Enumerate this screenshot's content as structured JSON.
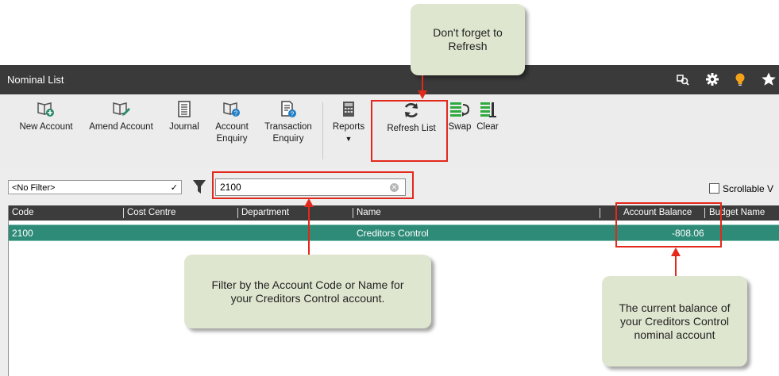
{
  "window": {
    "title": "Nominal List",
    "title_icons": [
      "search-records-icon",
      "gear-icon",
      "lightbulb-icon",
      "star-icon"
    ]
  },
  "toolbar": {
    "new_account": "New Account",
    "amend_account": "Amend Account",
    "journal": "Journal",
    "account_enquiry_1": "Account",
    "account_enquiry_2": "Enquiry",
    "transaction_enquiry_1": "Transaction",
    "transaction_enquiry_2": "Enquiry",
    "reports": "Reports",
    "refresh_list": "Refresh List",
    "swap": "Swap",
    "clear": "Clear"
  },
  "filter": {
    "selected": "<No Filter>",
    "search_value": "2100",
    "scrollable_label": "Scrollable V"
  },
  "grid": {
    "columns": [
      "Code",
      "Cost Centre",
      "Department",
      "Name",
      "Account Balance",
      "Budget Name"
    ],
    "rows": [
      {
        "code": "2100",
        "cost_centre": "",
        "department": "",
        "name": "Creditors Control",
        "account_balance": "-808.06",
        "budget_name": ""
      }
    ]
  },
  "callouts": {
    "refresh_1": "Don't forget to",
    "refresh_2": "Refresh",
    "filter_1": "Filter by the Account Code or Name for",
    "filter_2": "your Creditors Control account.",
    "balance_1": "The current balance of",
    "balance_2": "your Creditors Control",
    "balance_3": "nominal account"
  },
  "colors": {
    "titlebar": "#3a3a3a",
    "selected_row": "#2e8b78",
    "highlight": "#e3281c",
    "callout_bg": "#dfe6cf",
    "toolbar_green": "#2eaa3e"
  }
}
